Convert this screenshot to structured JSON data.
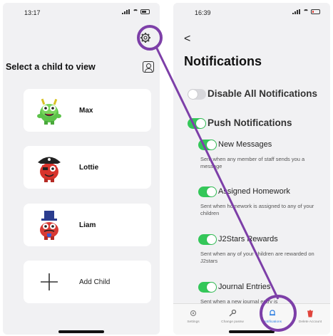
{
  "left": {
    "status_time": "13:17",
    "select_title": "Select a child to view",
    "children": [
      {
        "name": "Max"
      },
      {
        "name": "Lottie"
      },
      {
        "name": "Liam"
      }
    ],
    "add_child_label": "Add Child"
  },
  "right": {
    "status_time": "16:39",
    "back_glyph": "<",
    "title": "Notifications",
    "disable_all": {
      "label": "Disable All Notifications",
      "on": false
    },
    "push": {
      "label": "Push Notifications",
      "on": true
    },
    "items": [
      {
        "label": "New Messages",
        "desc": "Sent when any member of staff sends you a message",
        "on": true
      },
      {
        "label": "Assigned Homework",
        "desc": "Sent when homework is assigned to any of your children",
        "on": true
      },
      {
        "label": "J2Stars Rewards",
        "desc": "Sent when any of your children are rewarded on J2stars",
        "on": true
      },
      {
        "label": "Journal Entries",
        "desc": "Sent when a new journal entry is",
        "on": true
      }
    ],
    "tabs": [
      {
        "label": "Settings",
        "icon": "gear-icon"
      },
      {
        "label": "Change passw",
        "icon": "key-icon"
      },
      {
        "label": "Notifications",
        "icon": "bell-icon"
      },
      {
        "label": "Delete Account",
        "icon": "trash-icon"
      }
    ]
  },
  "colors": {
    "accent": "#2a7de1",
    "toggle_on": "#34c759",
    "highlight": "#7d3fa8"
  }
}
